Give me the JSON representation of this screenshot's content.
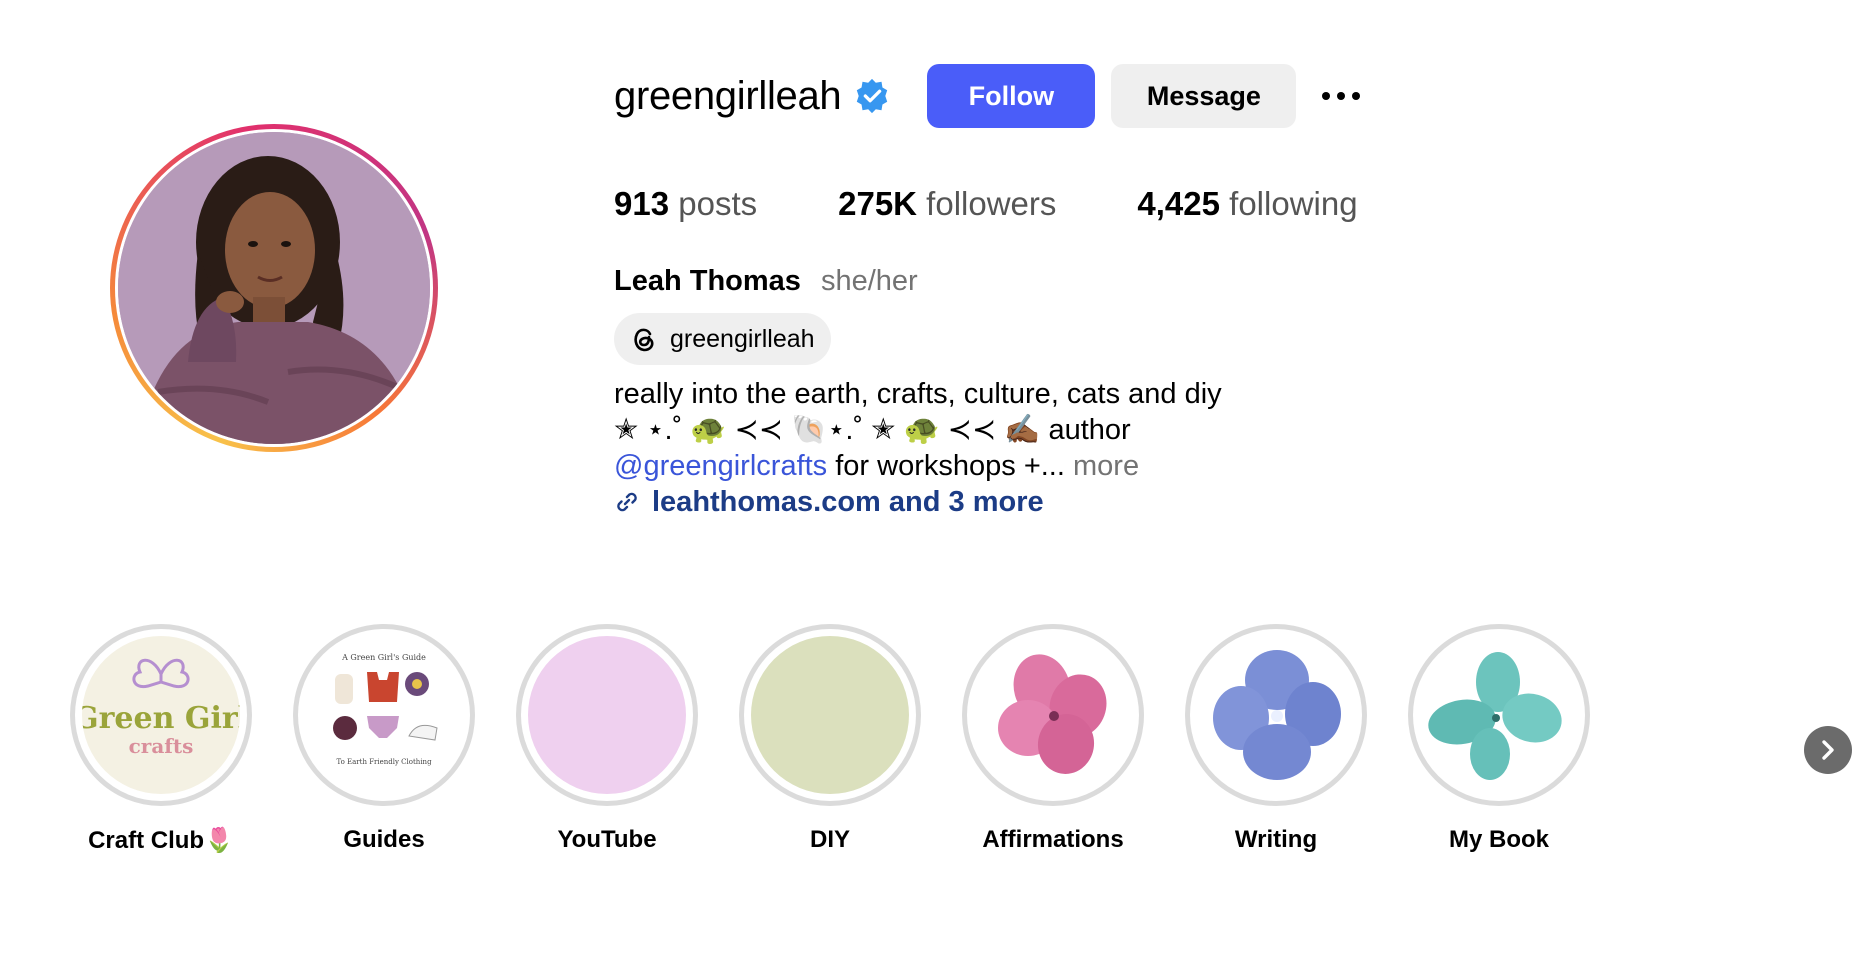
{
  "profile": {
    "username": "greengirlleah",
    "verified": true,
    "follow_label": "Follow",
    "message_label": "Message"
  },
  "stats": {
    "posts_count": "913",
    "posts_label": "posts",
    "followers_count": "275K",
    "followers_label": "followers",
    "following_count": "4,425",
    "following_label": "following"
  },
  "bio": {
    "full_name": "Leah Thomas",
    "pronouns": "she/her",
    "threads_handle": "greengirlleah",
    "line1": "really into the earth, crafts, culture, cats and diy",
    "line2": "✭ ⋆.˚ 🐢 ≺≺ 🐚⋆.˚ ✭ 🐢 ≺≺ ✍🏾 author",
    "mention": "@greengirlcrafts",
    "line3_rest": " for workshops +...",
    "more_label": " more",
    "link_text": "leahthomas.com and 3 more"
  },
  "highlights": [
    {
      "label": "Craft Club🌷",
      "image_text": "Green Girl",
      "image_subtext": "crafts"
    },
    {
      "label": "Guides",
      "image_text": "A Green Girl's Guide",
      "image_subtext": "To Earth Friendly Clothing"
    },
    {
      "label": "YouTube"
    },
    {
      "label": "DIY"
    },
    {
      "label": "Affirmations"
    },
    {
      "label": "Writing"
    },
    {
      "label": "My Book"
    }
  ],
  "colors": {
    "follow_button": "#4a5df9",
    "verified_badge": "#3797f0",
    "mention": "#3a55d9",
    "link": "#1c3c86",
    "youtube_cover": "#efd0ef",
    "diy_cover": "#dbe0bd"
  },
  "icons": {
    "verified": "verified-badge-icon",
    "more": "more-options-icon",
    "threads": "threads-icon",
    "link": "link-icon",
    "next": "chevron-right-icon"
  }
}
